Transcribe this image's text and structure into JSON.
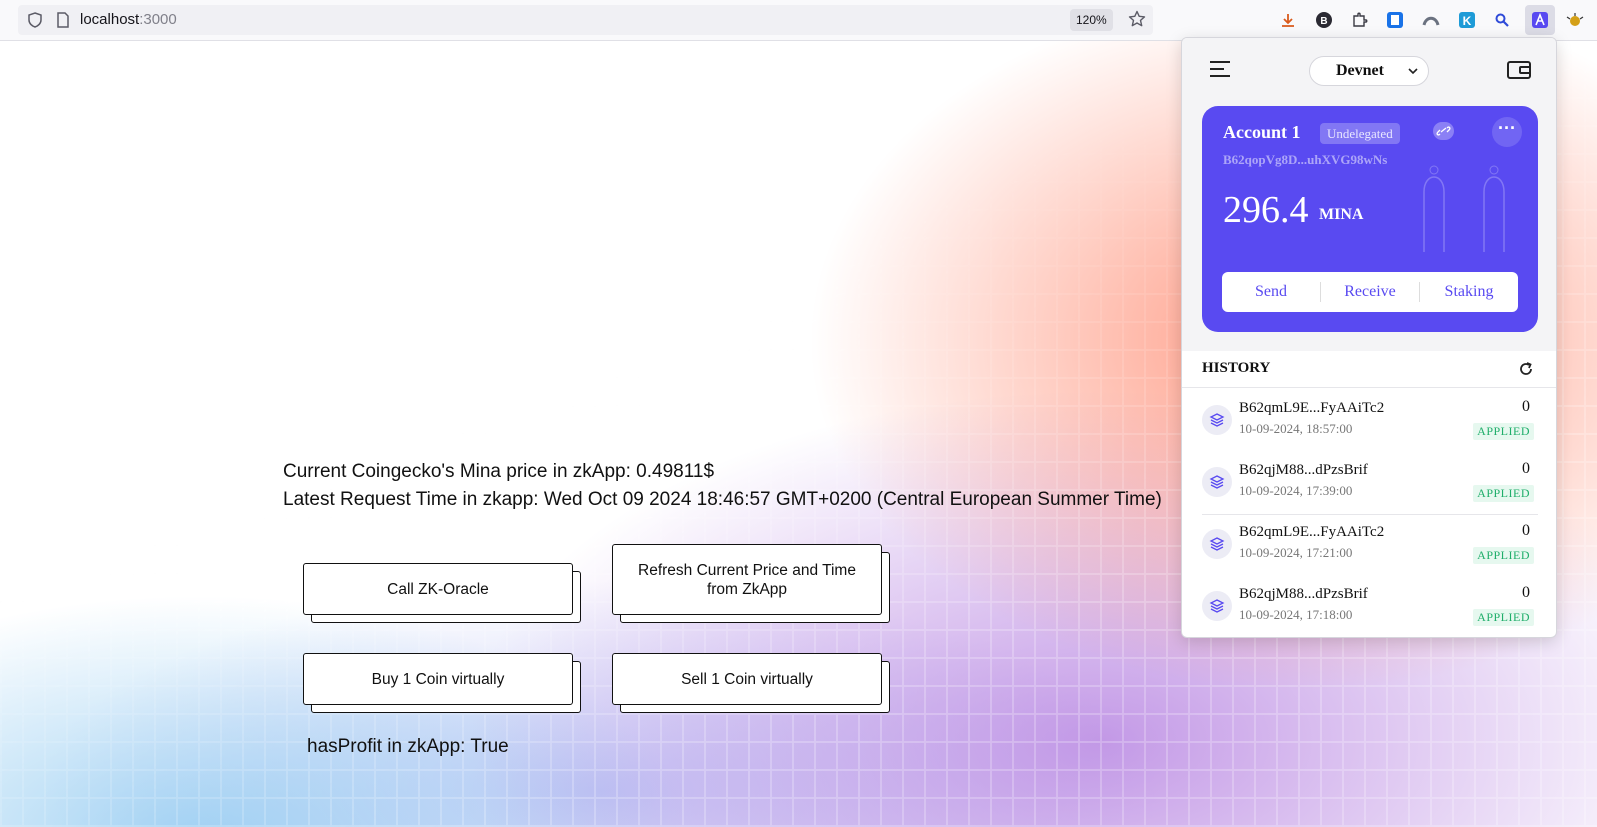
{
  "browser": {
    "url_host": "localhost",
    "url_port": ":3000",
    "zoom": "120%"
  },
  "app": {
    "price_line": "Current Coingecko's Mina price in zkApp: 0.49811$",
    "time_line": "Latest Request Time in zkapp: Wed Oct 09 2024 18:46:57 GMT+0200 (Central European Summer Time)",
    "buttons": {
      "call_oracle": "Call ZK-Oracle",
      "refresh": "Refresh Current Price and Time from ZkApp",
      "buy": "Buy 1 Coin virtually",
      "sell": "Sell 1 Coin virtually"
    },
    "profit_line": "hasProfit in zkApp: True"
  },
  "wallet": {
    "network": "Devnet",
    "account": {
      "name": "Account 1",
      "badge": "Undelegated",
      "address": "B62qopVg8D...uhXVG98wNs",
      "balance": "296.4",
      "unit": "MINA"
    },
    "actions": {
      "send": "Send",
      "receive": "Receive",
      "staking": "Staking"
    },
    "history_title": "HISTORY",
    "history": [
      {
        "address": "B62qmL9E...FyAAiTc2",
        "date": "10-09-2024, 18:57:00",
        "amount": "0",
        "status": "APPLIED"
      },
      {
        "address": "B62qjM88...dPzsBrif",
        "date": "10-09-2024, 17:39:00",
        "amount": "0",
        "status": "APPLIED"
      },
      {
        "address": "B62qmL9E...FyAAiTc2",
        "date": "10-09-2024, 17:21:00",
        "amount": "0",
        "status": "APPLIED"
      },
      {
        "address": "B62qjM88...dPzsBrif",
        "date": "10-09-2024, 17:18:00",
        "amount": "0",
        "status": "APPLIED"
      }
    ]
  },
  "colors": {
    "wallet_accent": "#594af1",
    "applied_green": "#1fae6a"
  },
  "extensions": [
    "download-icon",
    "b-icon",
    "puzzle-icon",
    "ext-blue-icon",
    "ext-arc-icon",
    "ext-k-icon",
    "magnifier-icon",
    "auro-wallet-icon",
    "ext-bug-icon"
  ]
}
